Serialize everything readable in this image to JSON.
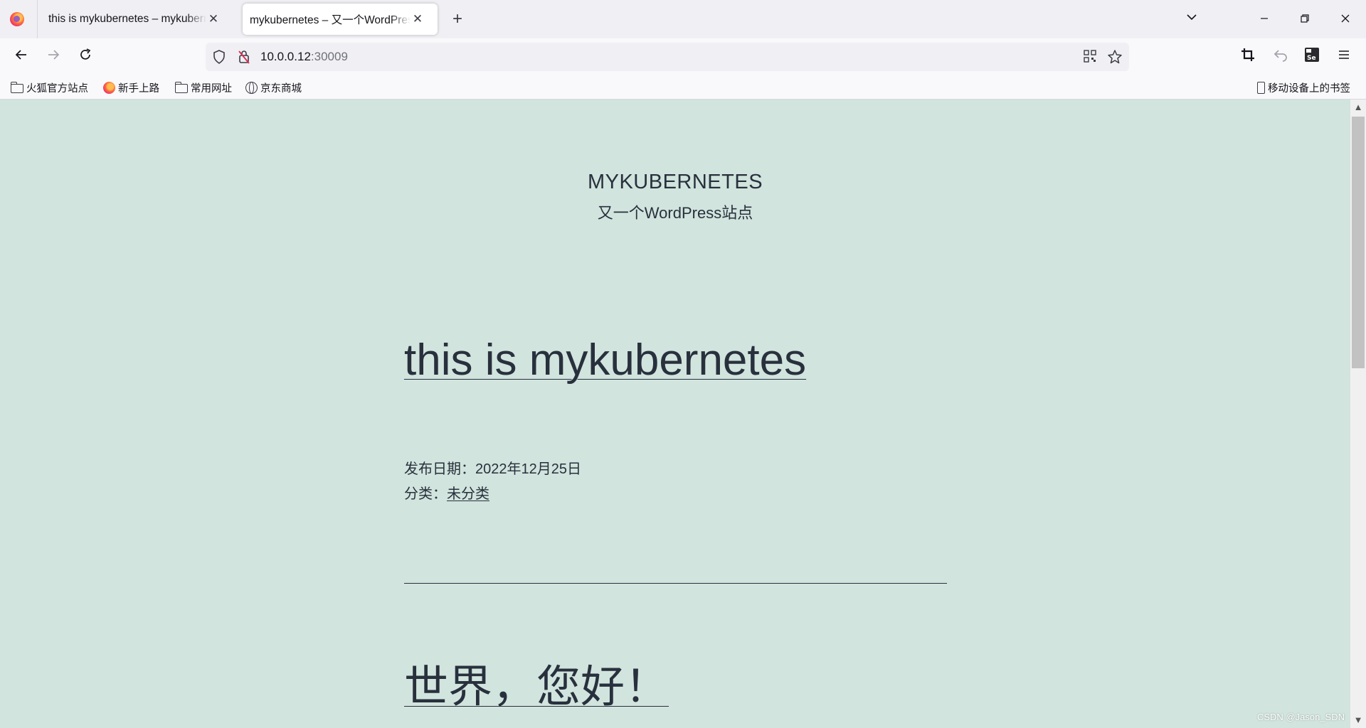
{
  "browser": {
    "tabs": [
      {
        "title": "this is mykubernetes – mykubernetes",
        "close": "✕"
      },
      {
        "title": "mykubernetes – 又一个WordPress站点",
        "close": "✕"
      }
    ],
    "new_tab": "+",
    "address": {
      "host": "10.0.0.12",
      "port": ":30009"
    },
    "bookmarks": [
      {
        "label": "火狐官方站点",
        "icon": "folder-icon"
      },
      {
        "label": "新手上路",
        "icon": "firefox-icon"
      },
      {
        "label": "常用网址",
        "icon": "folder-icon"
      },
      {
        "label": "京东商城",
        "icon": "globe-icon"
      }
    ],
    "mobile_bookmarks": "移动设备上的书签"
  },
  "site": {
    "title": "MYKUBERNETES",
    "description": "又一个WordPress站点"
  },
  "posts": [
    {
      "title": "this is mykubernetes",
      "date_label": "发布日期：",
      "date": "2022年12月25日",
      "category_label": "分类：",
      "category": "未分类"
    },
    {
      "title": "世界，您好！"
    }
  ],
  "watermark": "CSDN @Jason_SDN",
  "colors": {
    "page_background": "#d1e4dd",
    "text": "#28303d",
    "chrome": "#f0f0f4"
  }
}
